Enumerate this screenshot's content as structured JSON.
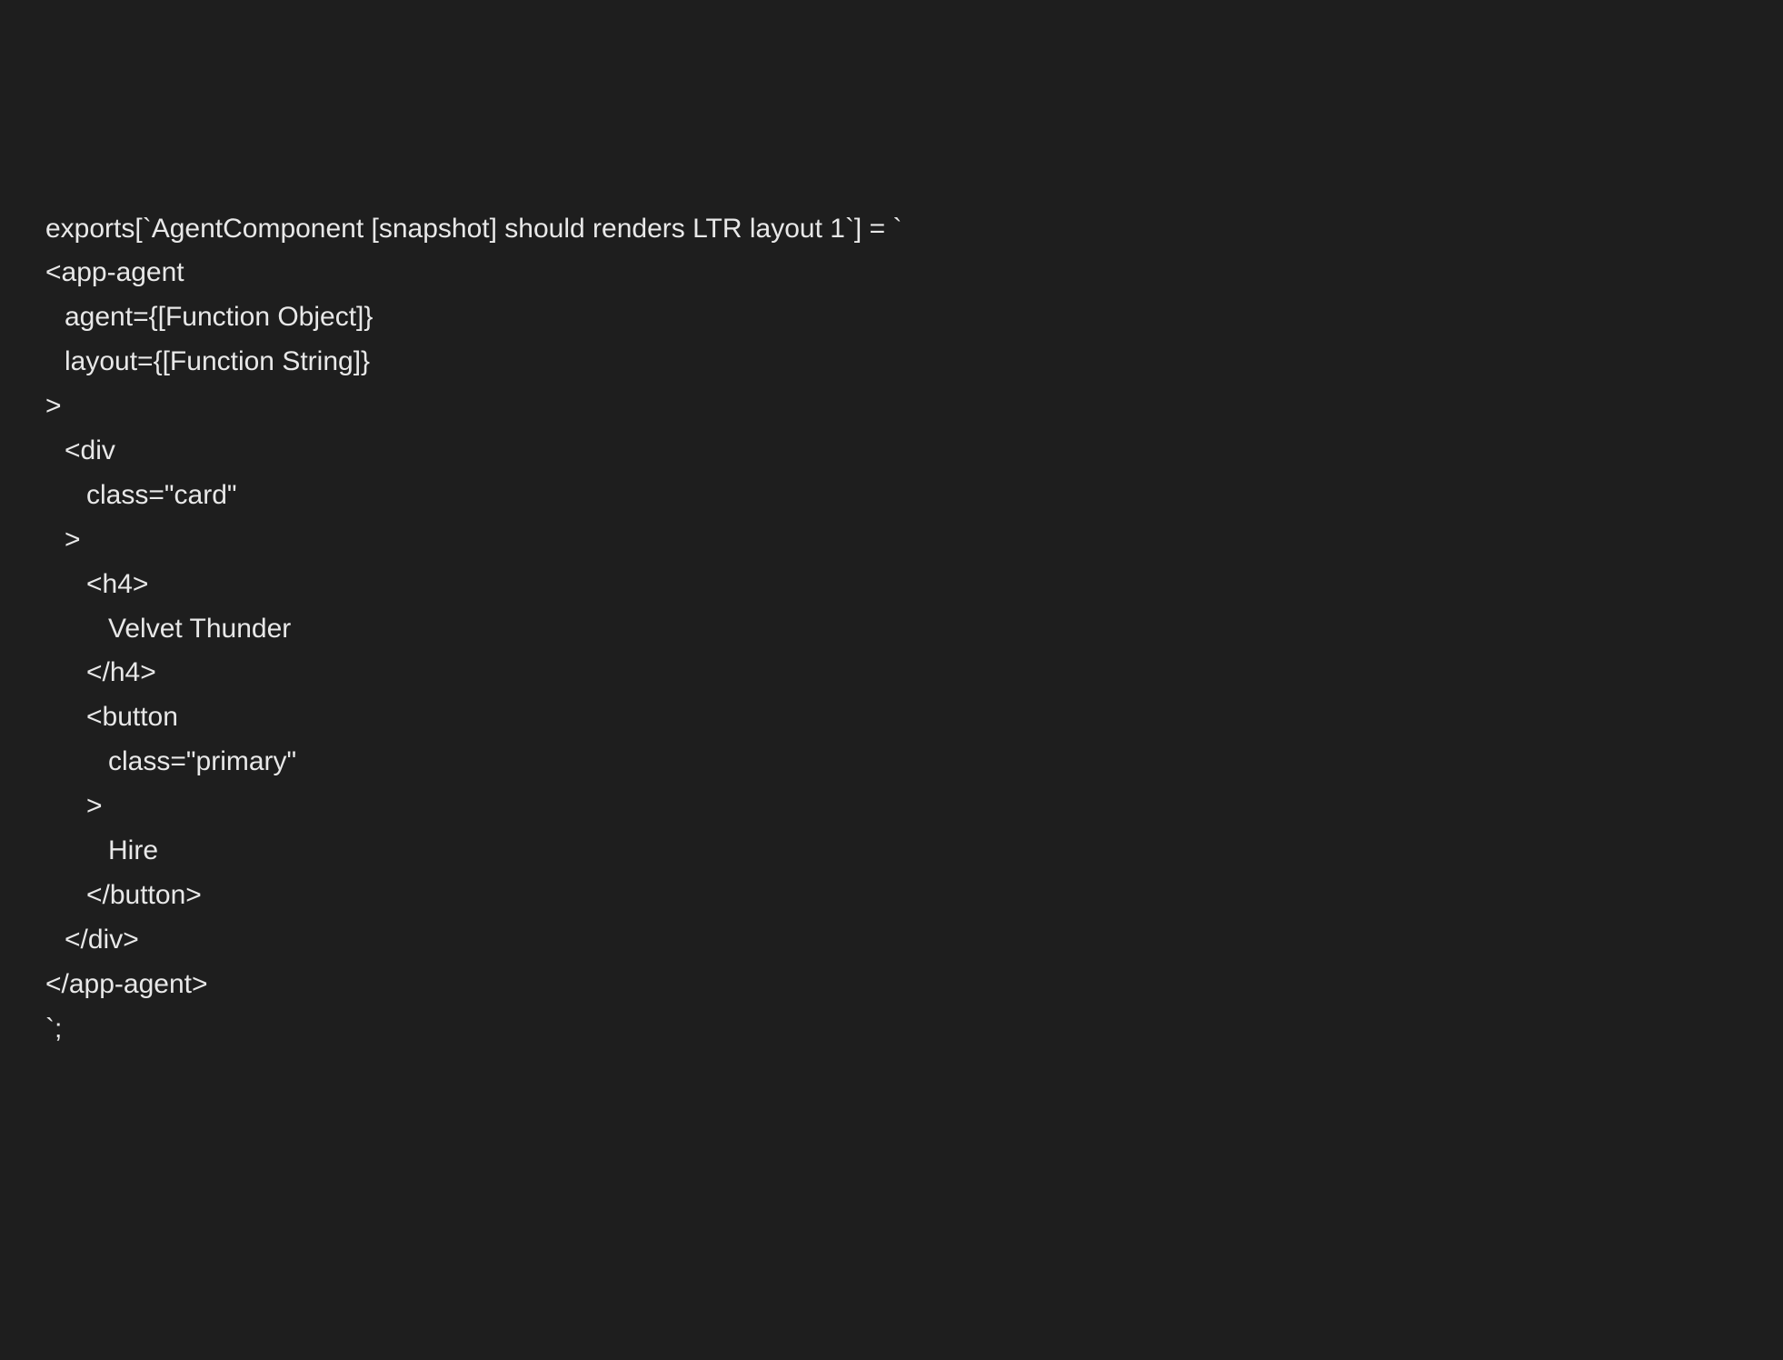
{
  "code": {
    "lines": [
      {
        "indent": 0,
        "text": "exports[`AgentComponent [snapshot] should renders LTR layout 1`] = `"
      },
      {
        "indent": 0,
        "text": "<app-agent"
      },
      {
        "indent": 1,
        "text": "agent={[Function Object]}"
      },
      {
        "indent": 1,
        "text": "layout={[Function String]}"
      },
      {
        "indent": 0,
        "text": ">"
      },
      {
        "indent": 1,
        "text": "<div"
      },
      {
        "indent": 2,
        "text": "class=\"card\""
      },
      {
        "indent": 1,
        "text": ">"
      },
      {
        "indent": 2,
        "text": "<h4>"
      },
      {
        "indent": 3,
        "text": "Velvet Thunder"
      },
      {
        "indent": 2,
        "text": "</h4>"
      },
      {
        "indent": 2,
        "text": "<button"
      },
      {
        "indent": 3,
        "text": "class=\"primary\""
      },
      {
        "indent": 2,
        "text": ">"
      },
      {
        "indent": 3,
        "text": "Hire"
      },
      {
        "indent": 2,
        "text": "</button>"
      },
      {
        "indent": 1,
        "text": "</div>"
      },
      {
        "indent": 0,
        "text": "</app-agent>"
      },
      {
        "indent": 0,
        "text": "`;"
      }
    ]
  }
}
